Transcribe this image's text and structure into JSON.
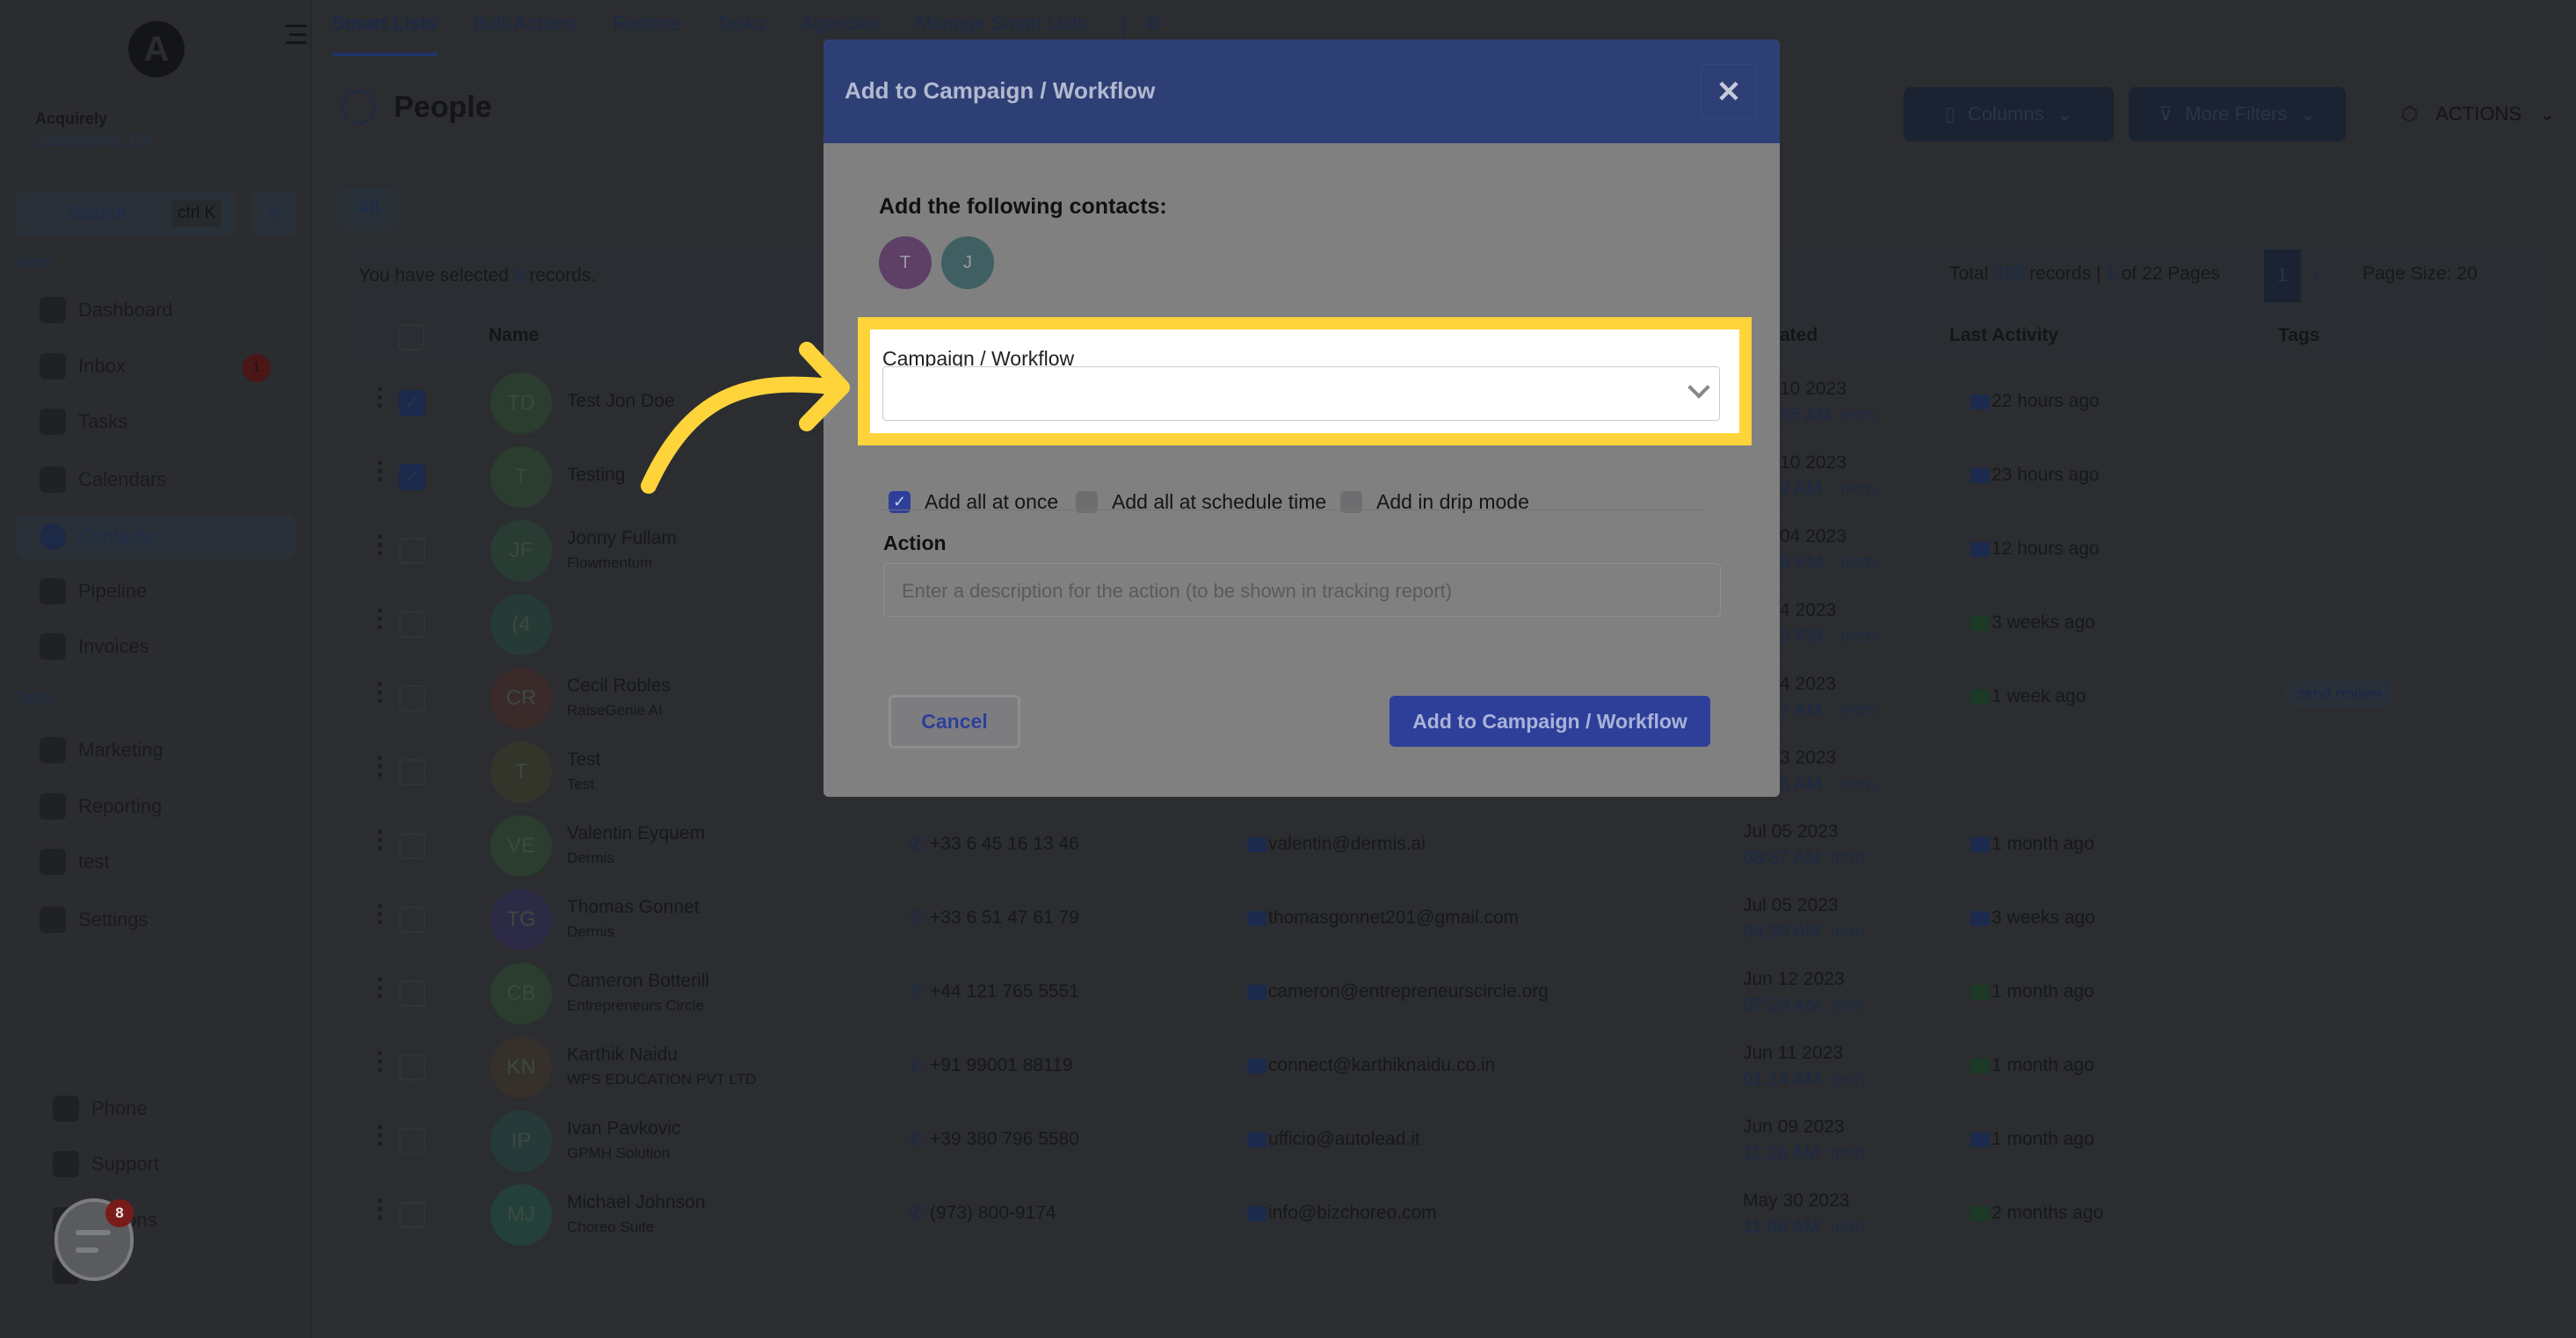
{
  "colors": {
    "accent": "#2e3f9a",
    "highlight": "#ffd43b",
    "modal_header": "#2e3f75"
  },
  "sidebar": {
    "logo": "A",
    "location": {
      "name": "Acquirely",
      "sub": "Sacramento, CA"
    },
    "search": {
      "label": "Search",
      "shortcut": "ctrl K"
    },
    "apps_label": "Apps",
    "tools_label": "Tools",
    "apps": [
      {
        "label": "Dashboard",
        "icon": "dashboard-icon"
      },
      {
        "label": "Inbox",
        "icon": "inbox-icon",
        "badge": "1"
      },
      {
        "label": "Tasks",
        "icon": "tasks-icon"
      },
      {
        "label": "Calendars",
        "icon": "calendar-icon"
      },
      {
        "label": "Contacts",
        "icon": "contacts-icon",
        "active": true
      },
      {
        "label": "Pipeline",
        "icon": "pipeline-icon"
      },
      {
        "label": "Invoices",
        "icon": "invoices-icon"
      }
    ],
    "tools": [
      {
        "label": "Marketing",
        "icon": "megaphone-icon"
      },
      {
        "label": "Reporting",
        "icon": "chart-icon"
      },
      {
        "label": "test",
        "icon": "accessibility-icon"
      },
      {
        "label": "Settings",
        "icon": "gear-icon"
      }
    ],
    "bottom": [
      {
        "label": "Phone",
        "icon": "phone-icon"
      },
      {
        "label": "Support",
        "icon": "support-icon"
      },
      {
        "label": "ications",
        "icon": "bell-icon"
      },
      {
        "label": "ile",
        "icon": "avatar-icon"
      }
    ],
    "chat_badge": "8"
  },
  "tabs": [
    "Smart Lists",
    "Bulk Actions",
    "Restore",
    "Tasks",
    "Agencies",
    "Manage Smart Lists"
  ],
  "page_title": "People",
  "filter_chip": "All",
  "toolbar": {
    "columns": "Columns",
    "more_filters": "More Filters",
    "actions": "ACTIONS"
  },
  "selection": {
    "prefix": "You have selected ",
    "count": "2",
    "suffix": " records."
  },
  "pagination": {
    "total_prefix": "Total ",
    "total": "428",
    "mid": " records | ",
    "page": "1",
    "of": " of 22 Pages",
    "current": "1",
    "page_size": "Page Size: 20"
  },
  "table": {
    "headers": {
      "name": "Name",
      "created": "ated",
      "last_activity": "Last Activity",
      "tags": "Tags"
    },
    "rows": [
      {
        "checked": true,
        "initials": "TD",
        "avatar": "#2a3d2e",
        "name": "Test Jon Doe",
        "company": "",
        "phone": "",
        "email": "",
        "date": "10 2023",
        "time": "55 AM",
        "tz": "(PDT)",
        "activity": "22 hours ago",
        "activity_type": "email",
        "tag": "",
        "clip": true
      },
      {
        "checked": true,
        "initials": "T",
        "avatar": "#2a3d2e",
        "name": "Testing",
        "company": "",
        "phone": "",
        "email": "",
        "date": "10 2023",
        "time": "9 AM",
        "tz": "(PDT)",
        "activity": "23 hours ago",
        "activity_type": "email",
        "tag": "",
        "clip": true
      },
      {
        "checked": false,
        "initials": "JF",
        "avatar": "#283c33",
        "name": "Jonny Fullam",
        "company": "Flowmentum",
        "phone": "",
        "email": "",
        "date": "04 2023",
        "time": "8 PM",
        "tz": "(PDT)",
        "activity": "12 hours ago",
        "activity_type": "email",
        "tag": "",
        "clip": true
      },
      {
        "checked": false,
        "initials": "(4",
        "avatar": "#263a36",
        "name": "",
        "company": "",
        "phone": "",
        "email": "",
        "date": "4 2023",
        "time": "9 PM",
        "tz": "(PDT)",
        "activity": "3 weeks ago",
        "activity_type": "sms",
        "tag": "",
        "clip": true
      },
      {
        "checked": false,
        "initials": "CR",
        "avatar": "#3a2a2a",
        "name": "Cecil Robles",
        "company": "RaiseGenie AI",
        "phone": "",
        "email": "",
        "date": "4 2023",
        "time": "7 AM",
        "tz": "(PDT)",
        "activity": "1 week ago",
        "activity_type": "sms",
        "tag": "send review",
        "clip": true
      },
      {
        "checked": false,
        "initials": "T",
        "avatar": "#34352a",
        "name": "Test",
        "company": "Test",
        "phone": "",
        "email": "",
        "date": "3 2023",
        "time": "6 AM",
        "tz": "(PDT)",
        "activity": "",
        "activity_type": "",
        "tag": "",
        "clip": true
      },
      {
        "checked": false,
        "initials": "VE",
        "avatar": "#2a3d2e",
        "name": "Valentin Eyquem",
        "company": "Dermis",
        "phone": "+33 6 45 16 13 46",
        "email": "valentin@dermis.ai",
        "date": "Jul 05 2023",
        "time": "08:37 AM",
        "tz": "(PDT)",
        "activity": "1 month ago",
        "activity_type": "email",
        "tag": ""
      },
      {
        "checked": false,
        "initials": "TG",
        "avatar": "#2d2a45",
        "name": "Thomas Gonnet",
        "company": "Dermis",
        "phone": "+33 6 51 47 61 79",
        "email": "thomasgonnet201@gmail.com",
        "date": "Jul 05 2023",
        "time": "04:39 AM",
        "tz": "(PDT)",
        "activity": "3 weeks ago",
        "activity_type": "email",
        "tag": ""
      },
      {
        "checked": false,
        "initials": "CB",
        "avatar": "#2a3d2e",
        "name": "Cameron Botterill",
        "company": "Entrepreneurs Circle",
        "phone": "+44 121 765 5551",
        "email": "cameron@entrepreneurscircle.org",
        "date": "Jun 12 2023",
        "time": "07:29 AM",
        "tz": "(PDT)",
        "activity": "1 month ago",
        "activity_type": "sms",
        "tag": ""
      },
      {
        "checked": false,
        "initials": "KN",
        "avatar": "#35302a",
        "name": "Karthik Naidu",
        "company": "WPS EDUCATION PVT LTD",
        "phone": "+91 99001 88119",
        "email": "connect@karthiknaidu.co.in",
        "date": "Jun 11 2023",
        "time": "01:14 AM",
        "tz": "(PDT)",
        "activity": "1 month ago",
        "activity_type": "sms",
        "tag": ""
      },
      {
        "checked": false,
        "initials": "IP",
        "avatar": "#263a3a",
        "name": "Ivan Pavkovic",
        "company": "GPMH Solution",
        "phone": "+39 380 796 5580",
        "email": "ufficio@autolead.it",
        "date": "Jun 09 2023",
        "time": "11:26 AM",
        "tz": "(PDT)",
        "activity": "1 month ago",
        "activity_type": "email",
        "tag": ""
      },
      {
        "checked": false,
        "initials": "MJ",
        "avatar": "#24403a",
        "name": "Michael Johnson",
        "company": "Choreo Suite",
        "phone": "(973) 800-9174",
        "email": "info@bizchoreo.com",
        "date": "May 30 2023",
        "time": "11:08 AM",
        "tz": "(PDT)",
        "activity": "2 months ago",
        "activity_type": "sms",
        "tag": ""
      }
    ]
  },
  "modal": {
    "title": "Add to Campaign / Workflow",
    "contacts_label": "Add the following contacts:",
    "contacts": [
      {
        "initial": "T",
        "color": "#5e3f66"
      },
      {
        "initial": "J",
        "color": "#3f5f63"
      }
    ],
    "campaign_label": "Campaign / Workflow",
    "campaign_value": "",
    "options": [
      {
        "label": "Add all at once",
        "checked": true
      },
      {
        "label": "Add all at schedule time",
        "checked": false
      },
      {
        "label": "Add in drip mode",
        "checked": false
      }
    ],
    "action_label": "Action",
    "action_placeholder": "Enter a description for the action (to be shown in tracking report)",
    "cancel": "Cancel",
    "submit": "Add to Campaign / Workflow"
  }
}
